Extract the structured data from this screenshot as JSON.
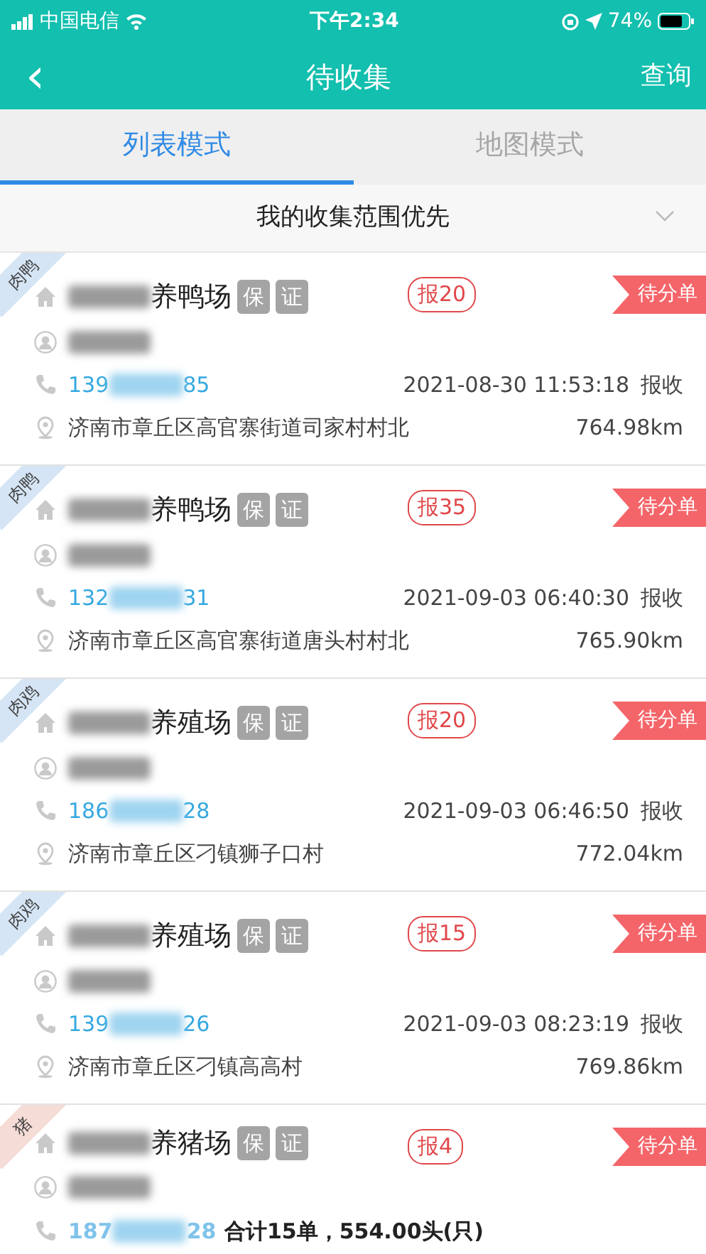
{
  "status_bar": {
    "carrier": "中国电信",
    "time": "下午2:34",
    "battery": "74%"
  },
  "header": {
    "back": "‹",
    "title": "待收集",
    "action": "查询"
  },
  "tabs": [
    {
      "label": "列表模式",
      "selected": true
    },
    {
      "label": "地图模式",
      "selected": false
    }
  ],
  "sort": {
    "label": "我的收集范围优先"
  },
  "cards": [
    {
      "category": "肉鸭",
      "color": "#d5e5f5",
      "farm_type": "养鸭场",
      "badges": [
        "保",
        "证"
      ],
      "report": "报20",
      "status": "待分单",
      "phone_prefix": "139",
      "phone_suffix": "85",
      "date": "2021-08-30 11:53:18",
      "action": "报收",
      "address": "济南市章丘区高官寨街道司家村村北",
      "distance": "764.98km"
    },
    {
      "category": "肉鸭",
      "color": "#d5e5f5",
      "farm_type": "养鸭场",
      "badges": [
        "保",
        "证"
      ],
      "report": "报35",
      "status": "待分单",
      "phone_prefix": "132",
      "phone_suffix": "31",
      "date": "2021-09-03 06:40:30",
      "action": "报收",
      "address": "济南市章丘区高官寨街道唐头村村北",
      "distance": "765.90km"
    },
    {
      "category": "肉鸡",
      "color": "#d5e5f5",
      "farm_type": "养殖场",
      "badges": [
        "保",
        "证"
      ],
      "report": "报20",
      "status": "待分单",
      "phone_prefix": "186",
      "phone_suffix": "28",
      "date": "2021-09-03 06:46:50",
      "action": "报收",
      "address": "济南市章丘区刁镇狮子口村",
      "distance": "772.04km"
    },
    {
      "category": "肉鸡",
      "color": "#d5e5f5",
      "farm_type": "养殖场",
      "badges": [
        "保",
        "证"
      ],
      "report": "报15",
      "status": "待分单",
      "phone_prefix": "139",
      "phone_suffix": "26",
      "date": "2021-09-03 08:23:19",
      "action": "报收",
      "address": "济南市章丘区刁镇高高村",
      "distance": "769.86km"
    },
    {
      "category": "猪",
      "color": "#f6dcd7",
      "farm_type": "养猪场",
      "badges": [
        "保",
        "证"
      ],
      "report": "报4",
      "status": "待分单",
      "phone_prefix": "187",
      "phone_suffix": "28"
    }
  ],
  "summary": "合计15单，554.00头(只)"
}
